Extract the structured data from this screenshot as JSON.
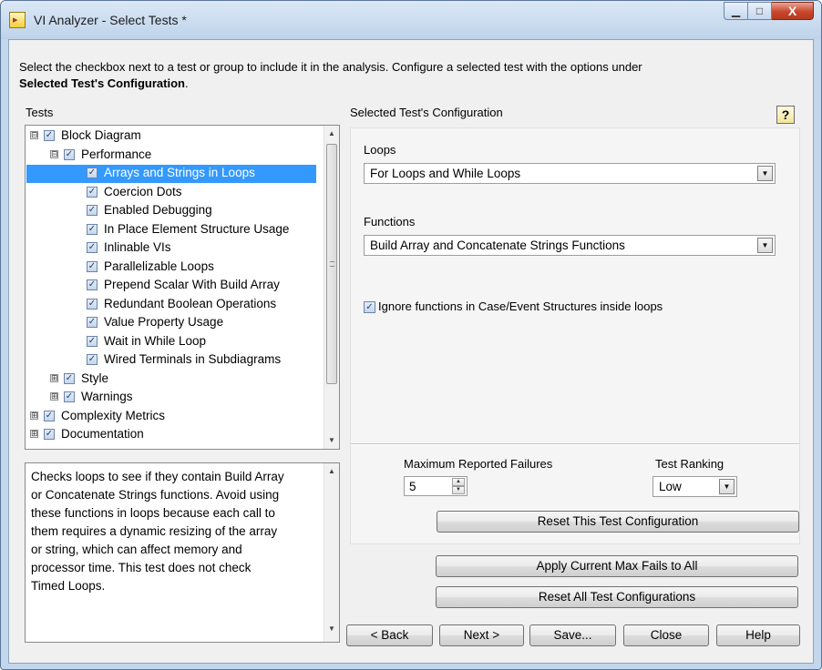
{
  "window": {
    "title": "VI Analyzer - Select Tests *",
    "controls": {
      "minimize": "▁",
      "maximize": "□",
      "close": "X"
    }
  },
  "intro": {
    "line1": "Select the checkbox next to a test or group to include it in the analysis.  Configure a selected test with the options under",
    "line2_bold": "Selected Test's Configuration",
    "line2_end": "."
  },
  "tests": {
    "label": "Tests",
    "tree": [
      {
        "label": "Block Diagram",
        "expander": "⊟",
        "checked": "✓"
      },
      {
        "label": "Performance",
        "expander": "⊟",
        "checked": "✓"
      },
      {
        "label": "Arrays and Strings in Loops",
        "checked": "✓"
      },
      {
        "label": "Coercion Dots",
        "checked": "✓"
      },
      {
        "label": "Enabled Debugging",
        "checked": "✓"
      },
      {
        "label": "In Place Element Structure Usage",
        "checked": "✓"
      },
      {
        "label": "Inlinable VIs",
        "checked": "✓"
      },
      {
        "label": "Parallelizable Loops",
        "checked": "✓"
      },
      {
        "label": "Prepend Scalar With Build Array",
        "checked": "✓"
      },
      {
        "label": "Redundant Boolean Operations",
        "checked": "✓"
      },
      {
        "label": "Value Property Usage",
        "checked": "✓"
      },
      {
        "label": "Wait in While Loop",
        "checked": "✓"
      },
      {
        "label": "Wired Terminals in Subdiagrams",
        "checked": "✓"
      },
      {
        "label": "Style",
        "expander": "⊞",
        "checked": "✓"
      },
      {
        "label": "Warnings",
        "expander": "⊞",
        "checked": "✓"
      },
      {
        "label": "Complexity Metrics",
        "expander": "⊞",
        "checked": "✓"
      },
      {
        "label": "Documentation",
        "expander": "⊞",
        "checked": "✓"
      }
    ],
    "selected": "Arrays and Strings in Loops"
  },
  "description": {
    "lines": [
      "Checks loops to see if they contain Build Array",
      "or Concatenate Strings functions. Avoid using",
      "these functions in loops because each call to",
      "them requires a dynamic resizing of the array",
      "or string, which can affect memory and",
      "processor time.  This test does not check",
      "Timed Loops."
    ]
  },
  "config": {
    "label": "Selected Test's Configuration",
    "help_icon": "?",
    "loops": {
      "label": "Loops",
      "value": "For Loops and While Loops"
    },
    "functions": {
      "label": "Functions",
      "value": "Build Array and Concatenate Strings Functions"
    },
    "ignore_case": {
      "label": "Ignore functions in Case/Event Structures inside loops",
      "checked": "✓"
    },
    "max_failures": {
      "label": "Maximum Reported Failures",
      "value": "5"
    },
    "ranking": {
      "label": "Test Ranking",
      "value": "Low"
    },
    "reset_this": "Reset This Test Configuration"
  },
  "buttons": {
    "apply_max": "Apply Current Max Fails to All",
    "reset_all": "Reset All Test Configurations",
    "back": "< Back",
    "next": "Next >",
    "save": "Save...",
    "close": "Close",
    "help": "Help"
  },
  "glyphs": {
    "up": "▲",
    "down": "▼",
    "check": "✓"
  }
}
